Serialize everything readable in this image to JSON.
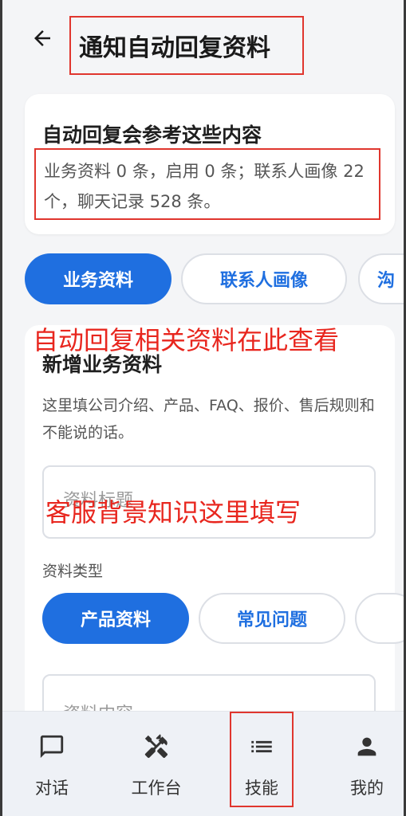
{
  "header": {
    "title": "通知自动回复资料"
  },
  "summary": {
    "title": "自动回复会参考这些内容",
    "description": "业务资料 0 条，启用 0 条；联系人画像 22 个，聊天记录 528 条。"
  },
  "tabs": [
    {
      "label": "业务资料",
      "active": true
    },
    {
      "label": "联系人画像",
      "active": false
    },
    {
      "label": "沟",
      "active": false
    }
  ],
  "add_section": {
    "title": "新增业务资料",
    "description": "这里填公司介绍、产品、FAQ、报价、售后规则和不能说的话。",
    "title_placeholder": "资料标题",
    "type_label": "资料类型",
    "types": [
      {
        "label": "产品资料",
        "active": true
      },
      {
        "label": "常见问题",
        "active": false
      }
    ],
    "content_placeholder": "资料内容"
  },
  "annotations": {
    "tabs_note": "自动回复相关资料在此查看",
    "input_note": "客服背景知识这里填写"
  },
  "bottom_nav": [
    {
      "label": "对话",
      "icon": "chat-icon"
    },
    {
      "label": "工作台",
      "icon": "tools-icon"
    },
    {
      "label": "技能",
      "icon": "list-icon"
    },
    {
      "label": "我的",
      "icon": "person-icon"
    }
  ],
  "colors": {
    "accent": "#1f6fe0",
    "annotation": "#e8261e",
    "background": "#f4f5f7"
  }
}
